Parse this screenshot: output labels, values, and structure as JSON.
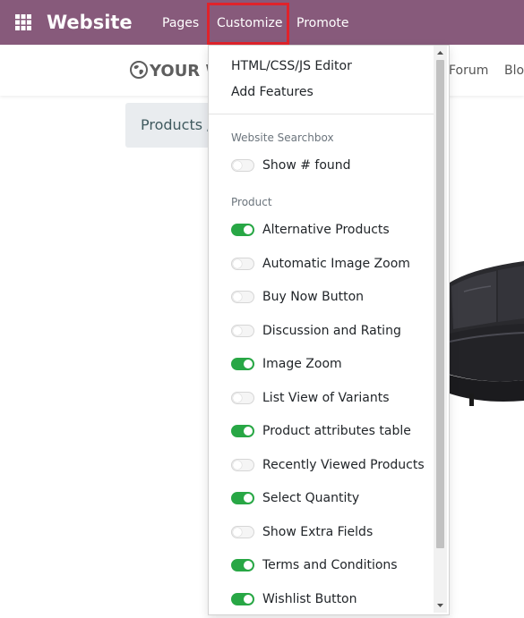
{
  "topbar": {
    "app_title": "Website",
    "nav": {
      "pages": "Pages",
      "customize": "Customize",
      "promote": "Promote"
    },
    "highlight_color": "#e0232b",
    "background_color": "#875a7b"
  },
  "site": {
    "logo_text": "YOUR W",
    "nav_forum": "Forum",
    "nav_blog": "Blo",
    "breadcrumb": "Products /"
  },
  "customize_menu": {
    "links": {
      "editor": "HTML/CSS/JS Editor",
      "add_features": "Add Features"
    },
    "sections": {
      "searchbox": {
        "header": "Website Searchbox",
        "options": [
          {
            "label": "Show # found",
            "enabled": false
          }
        ]
      },
      "product": {
        "header": "Product",
        "options": [
          {
            "label": "Alternative Products",
            "enabled": true
          },
          {
            "label": "Automatic Image Zoom",
            "enabled": false
          },
          {
            "label": "Buy Now Button",
            "enabled": false
          },
          {
            "label": "Discussion and Rating",
            "enabled": false
          },
          {
            "label": "Image Zoom",
            "enabled": true
          },
          {
            "label": "List View of Variants",
            "enabled": false
          },
          {
            "label": "Product attributes table",
            "enabled": true
          },
          {
            "label": "Recently Viewed Products",
            "enabled": false
          },
          {
            "label": "Select Quantity",
            "enabled": true
          },
          {
            "label": "Show Extra Fields",
            "enabled": false
          },
          {
            "label": "Terms and Conditions",
            "enabled": true
          },
          {
            "label": "Wishlist Button",
            "enabled": true
          }
        ]
      }
    },
    "toggle_on_color": "#28a745"
  }
}
